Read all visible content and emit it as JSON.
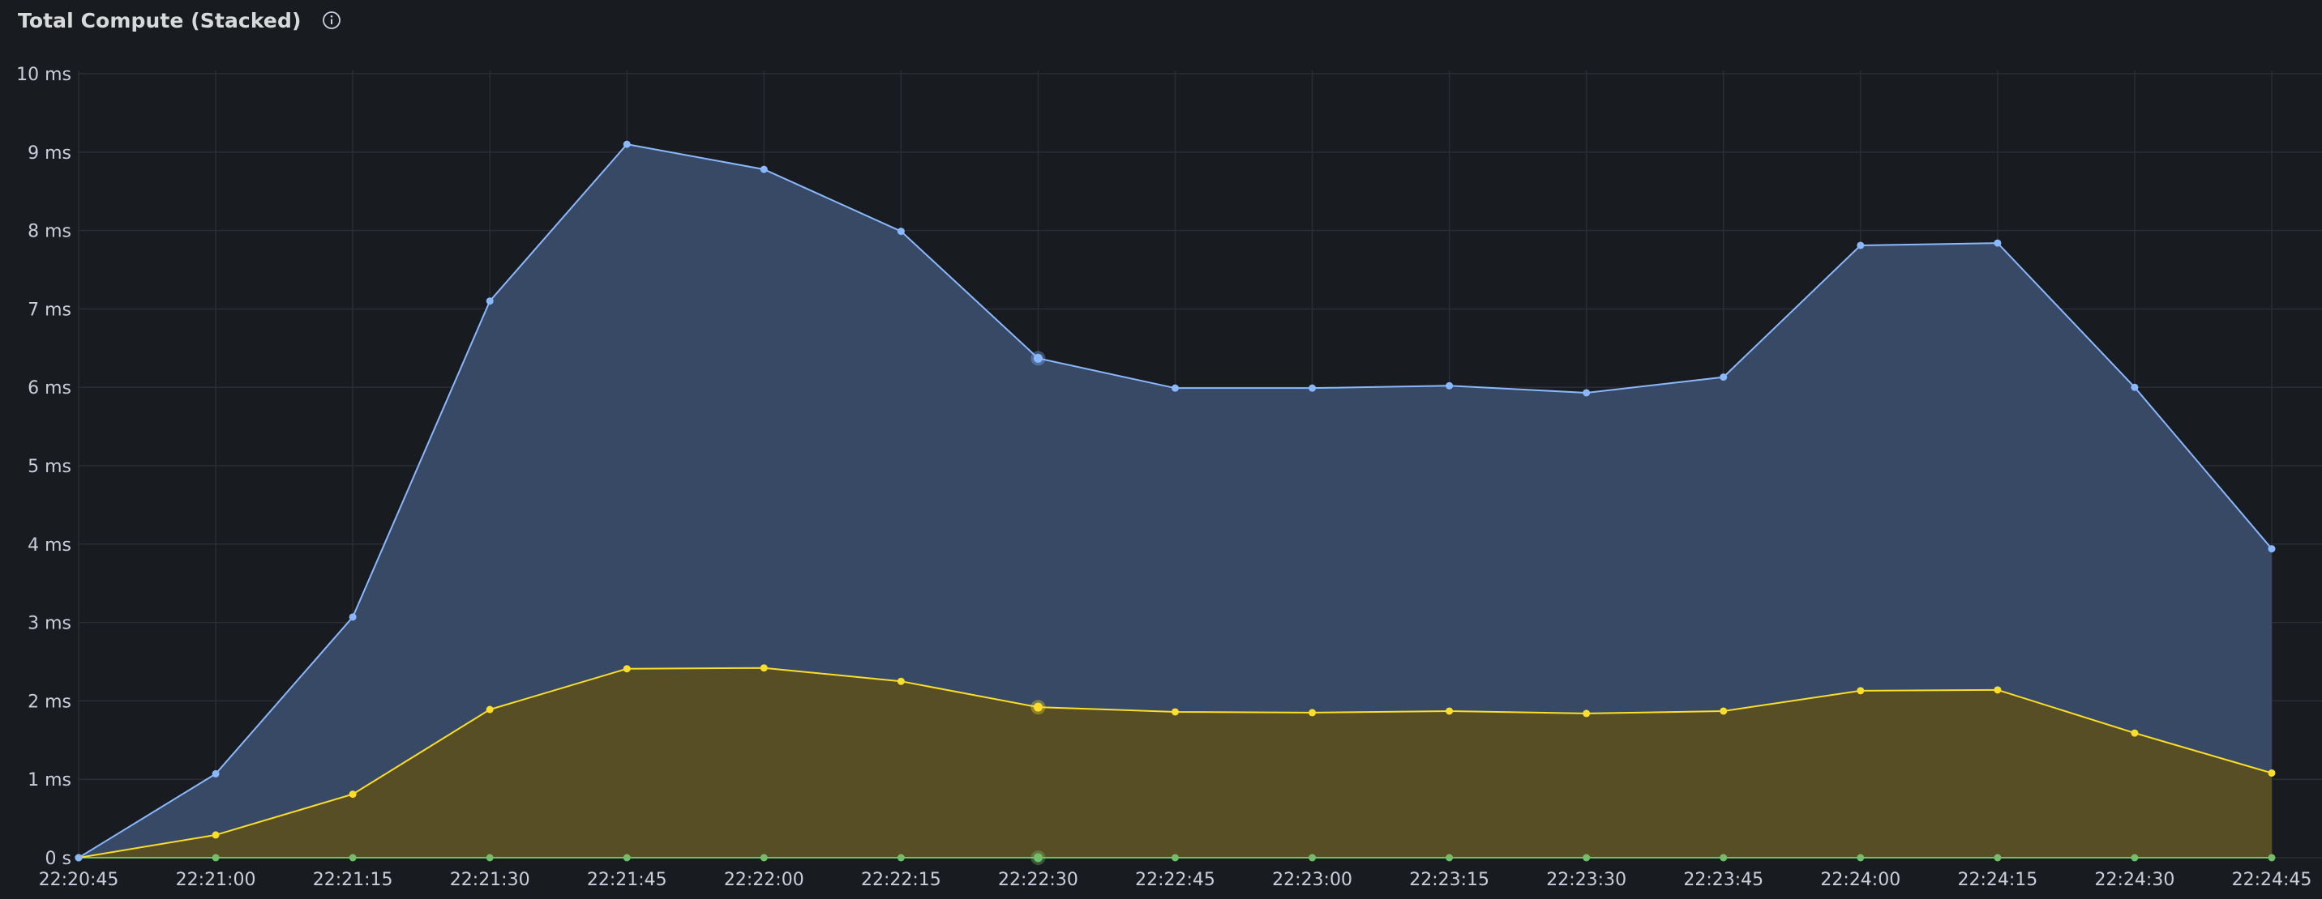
{
  "panel": {
    "title": "Total Compute (Stacked)",
    "info_icon": "info-circle-icon"
  },
  "chart_data": {
    "type": "area",
    "stacked": true,
    "title": "Total Compute (Stacked)",
    "xlabel": "",
    "ylabel": "",
    "x": [
      "22:20:45",
      "22:21:00",
      "22:21:15",
      "22:21:30",
      "22:21:45",
      "22:22:00",
      "22:22:15",
      "22:22:30",
      "22:22:45",
      "22:23:00",
      "22:23:15",
      "22:23:30",
      "22:23:45",
      "22:24:00",
      "22:24:15",
      "22:24:30",
      "22:24:45"
    ],
    "y_ticks": [
      "0 s",
      "1 ms",
      "2 ms",
      "3 ms",
      "4 ms",
      "5 ms",
      "6 ms",
      "7 ms",
      "8 ms",
      "9 ms",
      "10 ms"
    ],
    "ylim": [
      0,
      10
    ],
    "y_unit": "ms",
    "grid": true,
    "legend": "none",
    "highlight_x": "22:22:30",
    "series": [
      {
        "color": "#73bf69",
        "values": [
          0,
          0,
          0,
          0,
          0,
          0,
          0,
          0,
          0,
          0,
          0,
          0,
          0,
          0,
          0,
          0,
          0
        ]
      },
      {
        "color": "#fade2a",
        "values": [
          0,
          0.29,
          0.81,
          1.89,
          2.41,
          2.42,
          2.25,
          1.92,
          1.86,
          1.85,
          1.87,
          1.84,
          1.87,
          2.13,
          2.14,
          1.59,
          1.08
        ]
      },
      {
        "color": "#8ab8ff",
        "values": [
          0,
          0.78,
          2.26,
          5.21,
          6.69,
          6.36,
          5.74,
          4.45,
          4.13,
          4.14,
          4.15,
          4.09,
          4.26,
          5.68,
          5.7,
          4.41,
          2.86
        ]
      }
    ],
    "stacked_totals": [
      0,
      1.07,
      3.07,
      7.1,
      9.1,
      8.78,
      7.99,
      6.37,
      5.99,
      5.99,
      6.02,
      5.93,
      6.13,
      7.81,
      7.84,
      6.0,
      3.94
    ]
  }
}
